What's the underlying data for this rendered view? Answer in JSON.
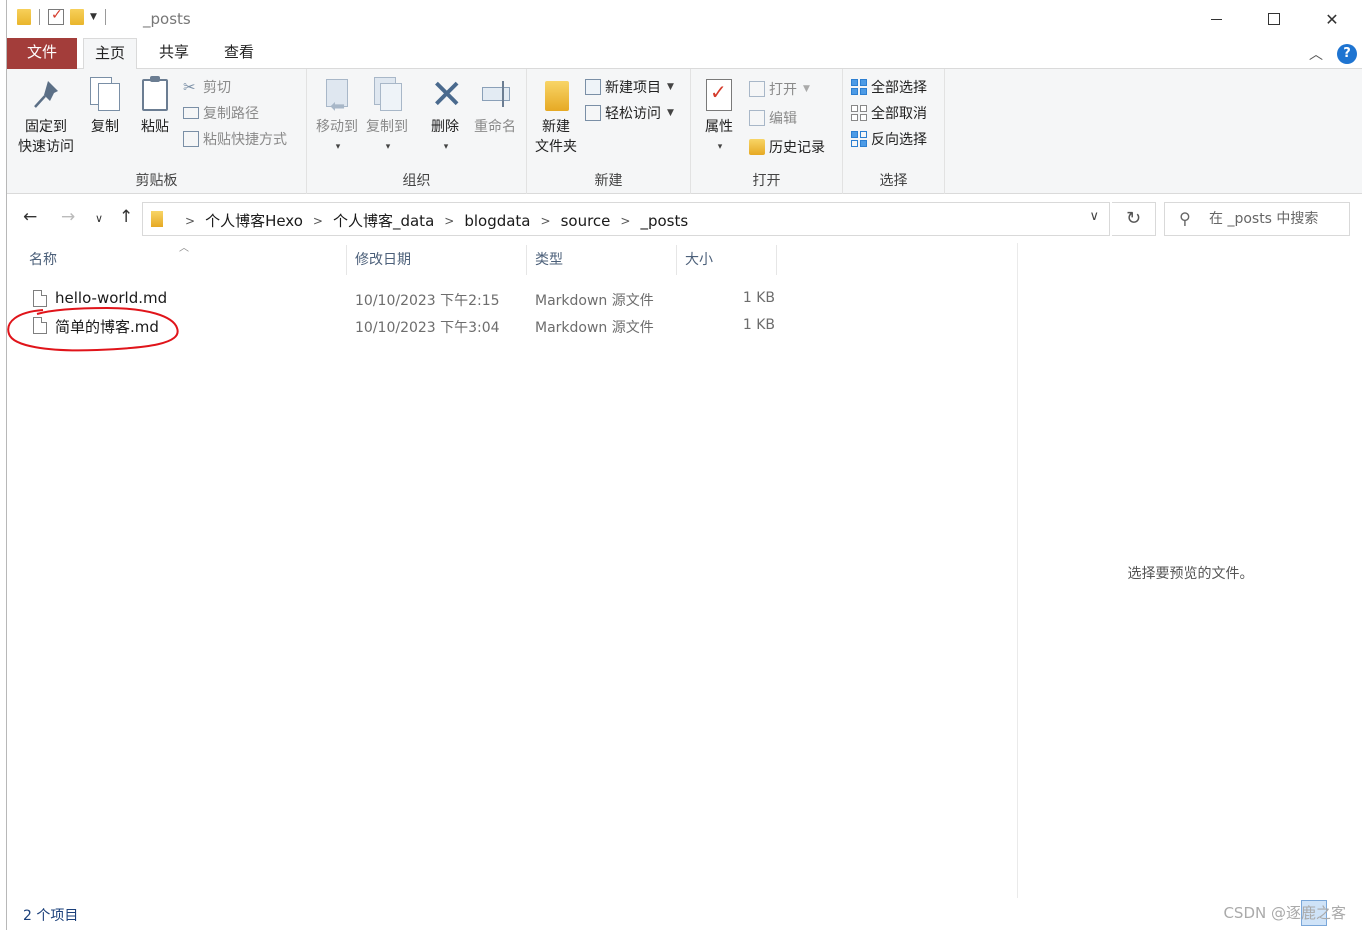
{
  "titlebar": {
    "title": "_posts"
  },
  "tabs": {
    "file": "文件",
    "home": "主页",
    "share": "共享",
    "view": "查看"
  },
  "ribbon": {
    "clipboard": {
      "label": "剪贴板",
      "pin": "固定到\n快速访问",
      "copy": "复制",
      "paste": "粘贴",
      "cut": "剪切",
      "copy_path": "复制路径",
      "paste_shortcut": "粘贴快捷方式"
    },
    "organize": {
      "label": "组织",
      "move_to": "移动到",
      "copy_to": "复制到",
      "delete": "删除",
      "rename": "重命名"
    },
    "new": {
      "label": "新建",
      "new_folder": "新建\n文件夹",
      "new_item": "新建项目",
      "easy_access": "轻松访问"
    },
    "open": {
      "label": "打开",
      "properties": "属性",
      "open": "打开",
      "edit": "编辑",
      "history": "历史记录"
    },
    "select": {
      "label": "选择",
      "select_all": "全部选择",
      "select_none": "全部取消",
      "invert": "反向选择"
    }
  },
  "address": {
    "crumbs": [
      "个人博客Hexo",
      "个人博客_data",
      "blogdata",
      "source",
      "_posts"
    ]
  },
  "search": {
    "placeholder": "在 _posts 中搜索"
  },
  "columns": {
    "name": "名称",
    "date": "修改日期",
    "type": "类型",
    "size": "大小"
  },
  "files": [
    {
      "name": "hello-world.md",
      "date": "10/10/2023 下午2:15",
      "type": "Markdown 源文件",
      "size": "1 KB"
    },
    {
      "name": "简单的博客.md",
      "date": "10/10/2023 下午3:04",
      "type": "Markdown 源文件",
      "size": "1 KB"
    }
  ],
  "preview": {
    "message": "选择要预览的文件。"
  },
  "status": {
    "count": "2 个项目",
    "watermark": "CSDN @逐鹿之客"
  },
  "colors": {
    "file_tab": "#a33d3a",
    "annotation": "#e0141a",
    "help": "#1e74d1"
  }
}
